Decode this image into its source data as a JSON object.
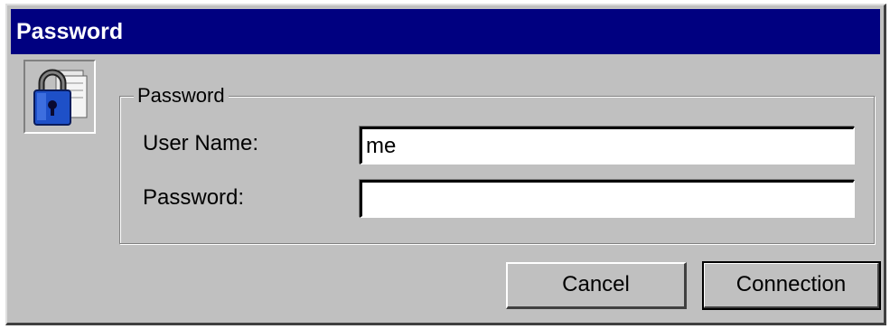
{
  "window": {
    "title": "Password"
  },
  "icon": {
    "name": "lock-icon"
  },
  "group": {
    "legend": "Password"
  },
  "fields": {
    "user_name_label": "User Name:",
    "user_name_value": "me",
    "password_label": "Password:",
    "password_value": ""
  },
  "buttons": {
    "cancel_label": "Cancel",
    "connection_label": "Connection"
  },
  "colors": {
    "titlebar": "#000080",
    "face": "#c0c0c0",
    "lock_blue": "#1e50c8"
  }
}
